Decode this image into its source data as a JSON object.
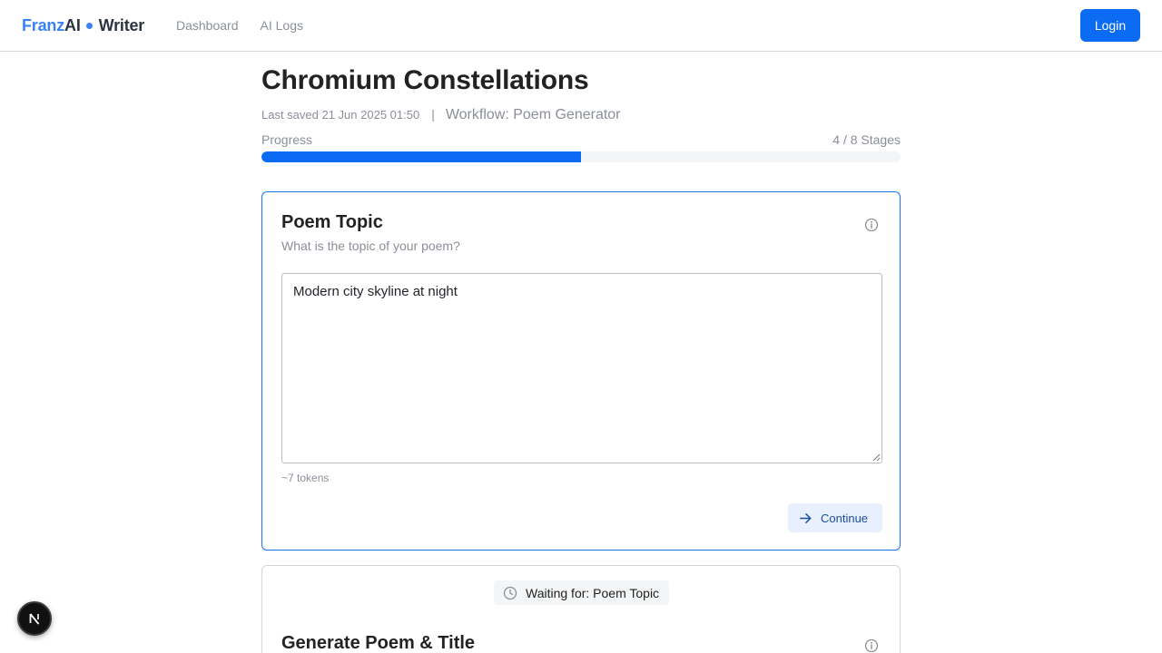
{
  "header": {
    "brand_franz": "Franz",
    "brand_ai": "AI",
    "brand_writer": "Writer",
    "nav": [
      "Dashboard",
      "AI Logs"
    ],
    "login_label": "Login"
  },
  "document": {
    "title": "Chromium Constellations",
    "last_saved": "Last saved 21 Jun 2025 01:50",
    "separator": "|",
    "workflow": "Workflow: Poem Generator"
  },
  "progress": {
    "label": "Progress",
    "count_text": "4 / 8 Stages",
    "completed": 4,
    "total": 8
  },
  "stages": [
    {
      "title": "Poem Topic",
      "question": "What is the topic of your poem?",
      "input_value": "Modern city skyline at night",
      "tokens": "~7 tokens",
      "continue_label": "Continue"
    },
    {
      "waiting_text": "Waiting for: Poem Topic",
      "title": "Generate Poem & Title"
    }
  ],
  "fab_letter": "N",
  "colors": {
    "accent": "#0b6bf2",
    "active_border": "#1a73e8",
    "muted_text": "#8a8f98"
  },
  "icons": {
    "info": "info-circle-icon",
    "continue": "arrow-right-icon",
    "waiting": "clock-icon",
    "fab": "nextjs-logo"
  }
}
